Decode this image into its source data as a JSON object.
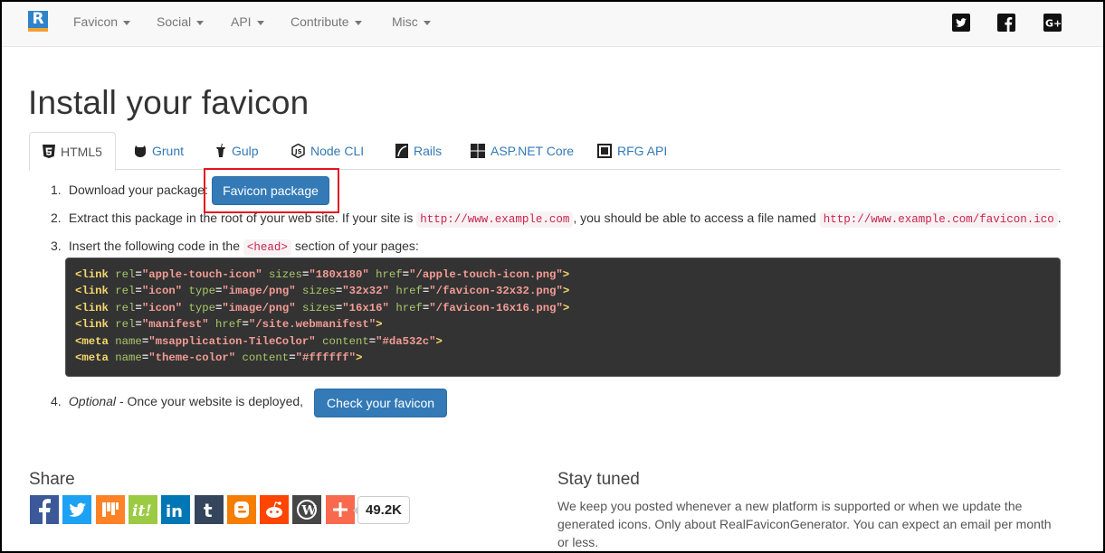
{
  "nav": {
    "brand_letter": "R",
    "items": [
      {
        "label": "Favicon"
      },
      {
        "label": "Social"
      },
      {
        "label": "API"
      },
      {
        "label": "Contribute"
      },
      {
        "label": "Misc"
      }
    ],
    "social_icons": [
      "twitter-icon",
      "facebook-icon",
      "google-plus-icon"
    ]
  },
  "page": {
    "title": "Install your favicon"
  },
  "tabs": [
    {
      "label": "HTML5",
      "icon": "html5-icon",
      "active": true
    },
    {
      "label": "Grunt",
      "icon": "grunt-icon"
    },
    {
      "label": "Gulp",
      "icon": "gulp-icon"
    },
    {
      "label": "Node CLI",
      "icon": "nodejs-icon"
    },
    {
      "label": "Rails",
      "icon": "rails-icon"
    },
    {
      "label": "ASP.NET Core",
      "icon": "windows-icon"
    },
    {
      "label": "RFG API",
      "icon": "api-icon"
    }
  ],
  "steps": {
    "s1": {
      "num": "1.",
      "text": "Download your package:",
      "button": "Favicon package"
    },
    "s2": {
      "num": "2.",
      "text_a": "Extract this package in the root of your web site. If your site is",
      "code_a": "http://www.example.com",
      "text_b": ", you should be able to access a file named",
      "code_b": "http://www.example.com/favicon.ico",
      "text_c": "."
    },
    "s3": {
      "num": "3.",
      "text_a": "Insert the following code in the",
      "code": "<head>",
      "text_b": "section of your pages:"
    },
    "s4": {
      "num": "4.",
      "optional": "Optional",
      "text": "- Once your website is deployed,",
      "button": "Check your favicon"
    }
  },
  "code_lines": [
    [
      [
        "t",
        "<link "
      ],
      [
        "a",
        "rel"
      ],
      [
        "p",
        "="
      ],
      [
        "v",
        "\"apple-touch-icon\""
      ],
      [
        "p",
        " "
      ],
      [
        "a",
        "sizes"
      ],
      [
        "p",
        "="
      ],
      [
        "v",
        "\"180x180\""
      ],
      [
        "p",
        " "
      ],
      [
        "a",
        "href"
      ],
      [
        "p",
        "="
      ],
      [
        "v",
        "\"/apple-touch-icon.png\""
      ],
      [
        "t",
        ">"
      ]
    ],
    [
      [
        "t",
        "<link "
      ],
      [
        "a",
        "rel"
      ],
      [
        "p",
        "="
      ],
      [
        "v",
        "\"icon\""
      ],
      [
        "p",
        " "
      ],
      [
        "a",
        "type"
      ],
      [
        "p",
        "="
      ],
      [
        "v",
        "\"image/png\""
      ],
      [
        "p",
        " "
      ],
      [
        "a",
        "sizes"
      ],
      [
        "p",
        "="
      ],
      [
        "v",
        "\"32x32\""
      ],
      [
        "p",
        " "
      ],
      [
        "a",
        "href"
      ],
      [
        "p",
        "="
      ],
      [
        "v",
        "\"/favicon-32x32.png\""
      ],
      [
        "t",
        ">"
      ]
    ],
    [
      [
        "t",
        "<link "
      ],
      [
        "a",
        "rel"
      ],
      [
        "p",
        "="
      ],
      [
        "v",
        "\"icon\""
      ],
      [
        "p",
        " "
      ],
      [
        "a",
        "type"
      ],
      [
        "p",
        "="
      ],
      [
        "v",
        "\"image/png\""
      ],
      [
        "p",
        " "
      ],
      [
        "a",
        "sizes"
      ],
      [
        "p",
        "="
      ],
      [
        "v",
        "\"16x16\""
      ],
      [
        "p",
        " "
      ],
      [
        "a",
        "href"
      ],
      [
        "p",
        "="
      ],
      [
        "v",
        "\"/favicon-16x16.png\""
      ],
      [
        "t",
        ">"
      ]
    ],
    [
      [
        "t",
        "<link "
      ],
      [
        "a",
        "rel"
      ],
      [
        "p",
        "="
      ],
      [
        "v",
        "\"manifest\""
      ],
      [
        "p",
        " "
      ],
      [
        "a",
        "href"
      ],
      [
        "p",
        "="
      ],
      [
        "v",
        "\"/site.webmanifest\""
      ],
      [
        "t",
        ">"
      ]
    ],
    [
      [
        "t",
        "<meta "
      ],
      [
        "a",
        "name"
      ],
      [
        "p",
        "="
      ],
      [
        "v",
        "\"msapplication-TileColor\""
      ],
      [
        "p",
        " "
      ],
      [
        "a",
        "content"
      ],
      [
        "p",
        "="
      ],
      [
        "v",
        "\"#da532c\""
      ],
      [
        "t",
        ">"
      ]
    ],
    [
      [
        "t",
        "<meta "
      ],
      [
        "a",
        "name"
      ],
      [
        "p",
        "="
      ],
      [
        "v",
        "\"theme-color\""
      ],
      [
        "p",
        " "
      ],
      [
        "a",
        "content"
      ],
      [
        "p",
        "="
      ],
      [
        "v",
        "\"#ffffff\""
      ],
      [
        "t",
        ">"
      ]
    ]
  ],
  "share": {
    "title": "Share",
    "count": "49.2K",
    "buttons": [
      {
        "name": "facebook-share-button",
        "color": "#3b5998"
      },
      {
        "name": "twitter-share-button",
        "color": "#1da1f2"
      },
      {
        "name": "mix-share-button",
        "color": "#ff8226"
      },
      {
        "name": "scoopit-share-button",
        "color": "#9bcb43"
      },
      {
        "name": "linkedin-share-button",
        "color": "#0077b5"
      },
      {
        "name": "tumblr-share-button",
        "color": "#35465c"
      },
      {
        "name": "blogger-share-button",
        "color": "#f57d00"
      },
      {
        "name": "reddit-share-button",
        "color": "#ff4500"
      },
      {
        "name": "wordpress-share-button",
        "color": "#464646"
      },
      {
        "name": "more-share-button",
        "color": "#f8694d"
      }
    ]
  },
  "stay_tuned": {
    "title": "Stay tuned",
    "text": "We keep you posted whenever a new platform is supported or when we update the generated icons. Only about RealFaviconGenerator. You can expect an email per month or less."
  },
  "colors": {
    "primary": "#337ab7",
    "highlight_border": "#e3141d",
    "code_bg": "#333333"
  }
}
